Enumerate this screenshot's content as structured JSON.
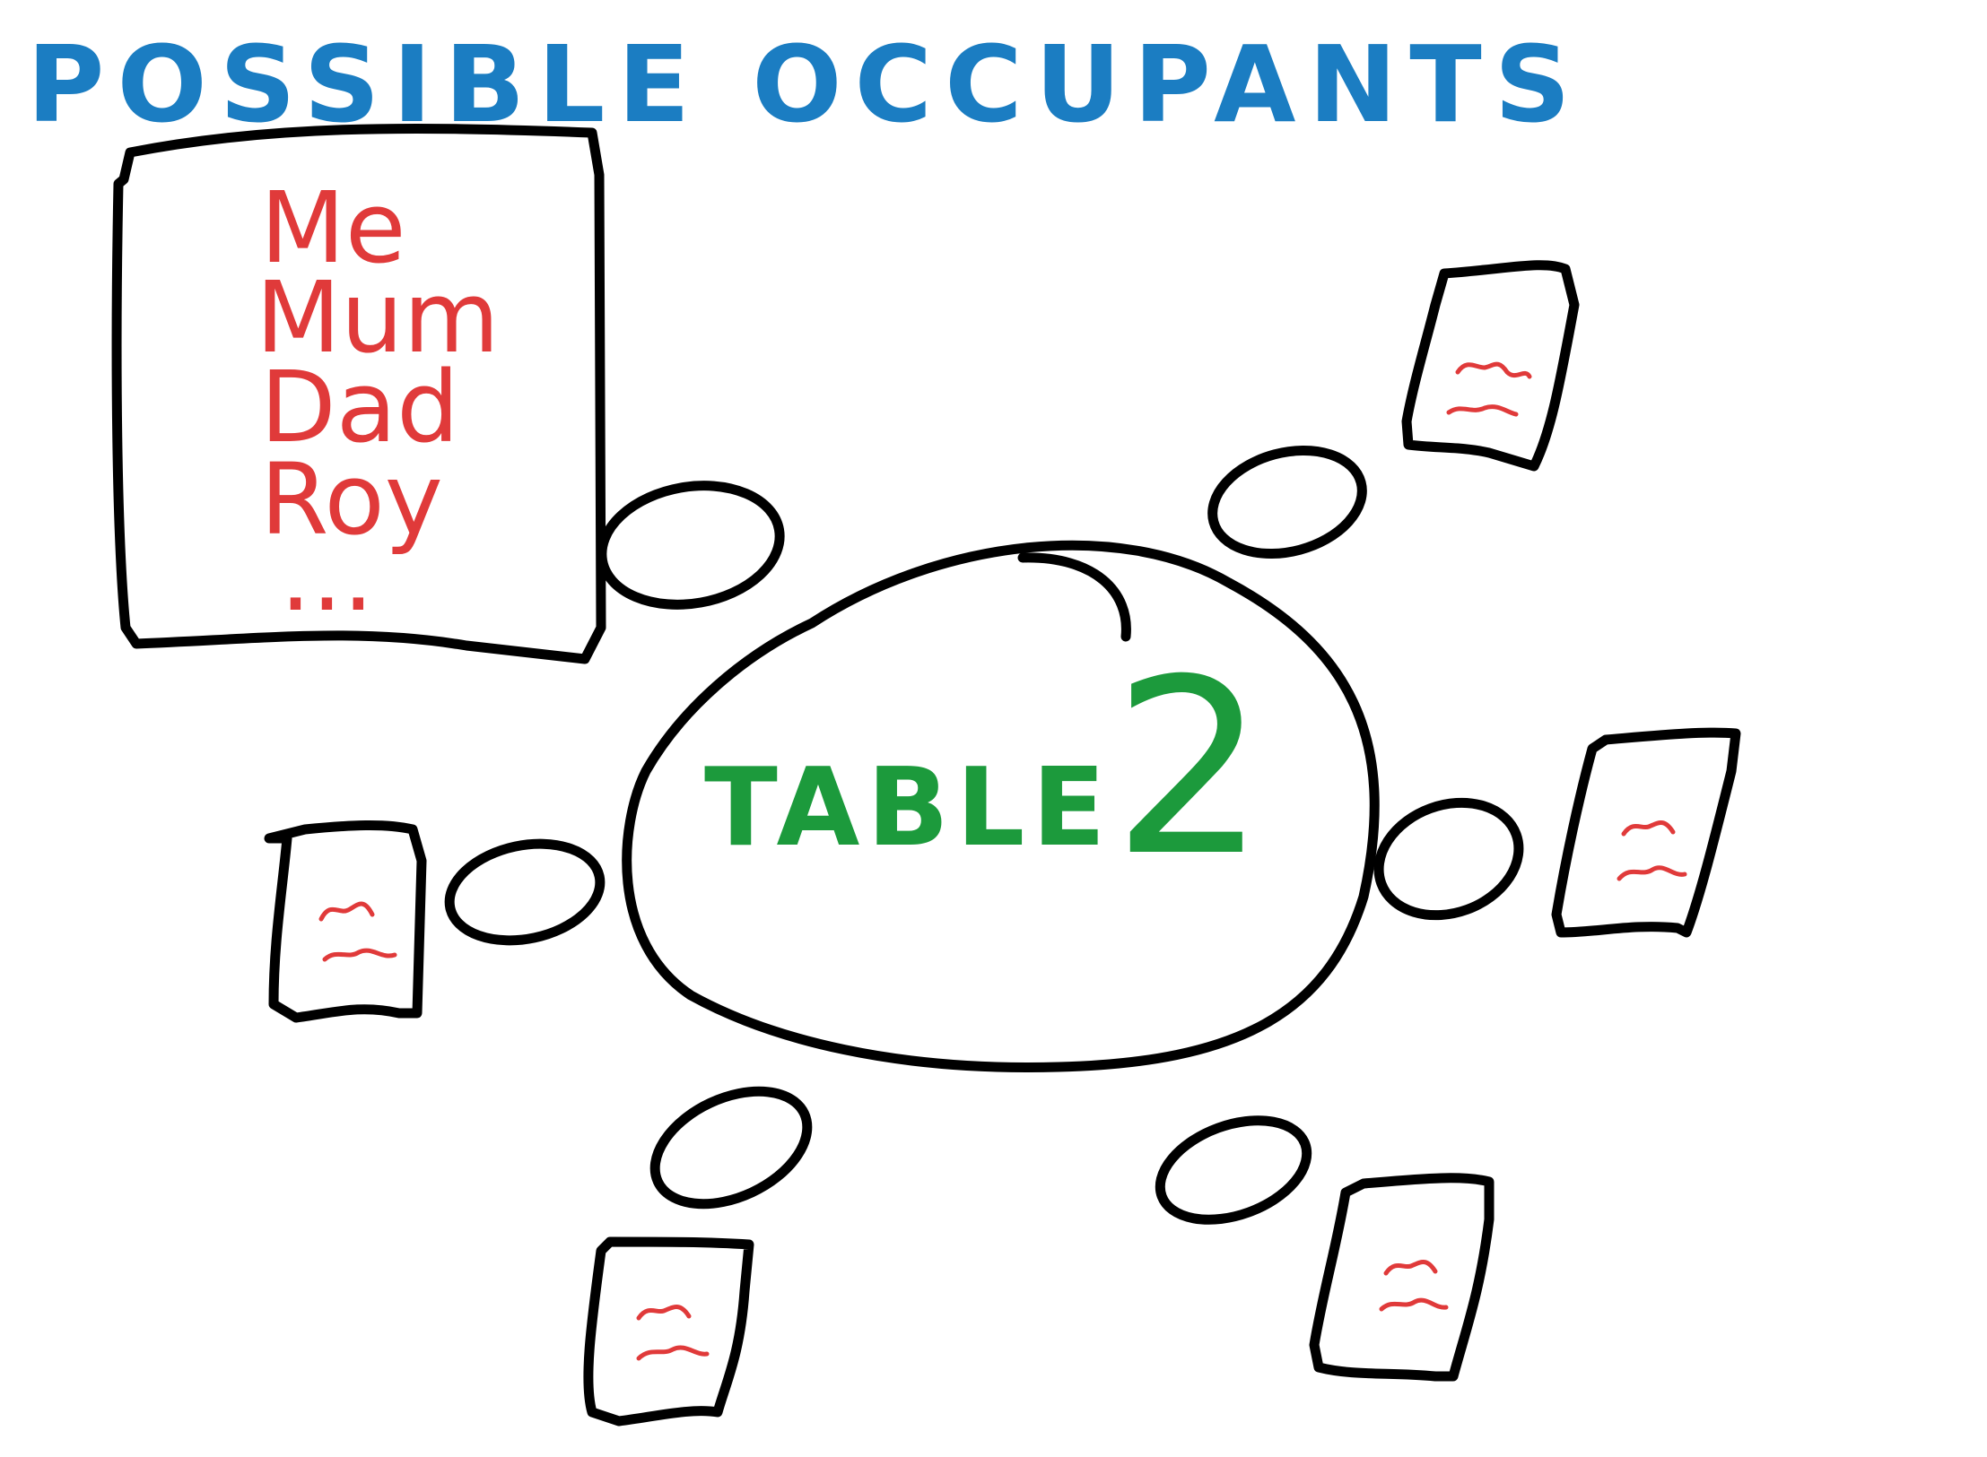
{
  "title": "POSSIBLE OCCUPANTS",
  "occupants_list": [
    "Me",
    "Mum",
    "Dad",
    "Roy",
    "..."
  ],
  "table": {
    "label": "TABLE",
    "number": "2"
  },
  "seats": [
    {
      "id": "top-left"
    },
    {
      "id": "top-right"
    },
    {
      "id": "left"
    },
    {
      "id": "right"
    },
    {
      "id": "bottom-left"
    },
    {
      "id": "bottom-right"
    }
  ],
  "place_cards": [
    {
      "id": "top-right"
    },
    {
      "id": "left"
    },
    {
      "id": "right"
    },
    {
      "id": "bottom-left"
    },
    {
      "id": "bottom-right"
    }
  ],
  "colors": {
    "title": "#1b7dc2",
    "occupants": "#e03a3a",
    "table_label": "#1c9a3c",
    "outline": "#000000"
  }
}
